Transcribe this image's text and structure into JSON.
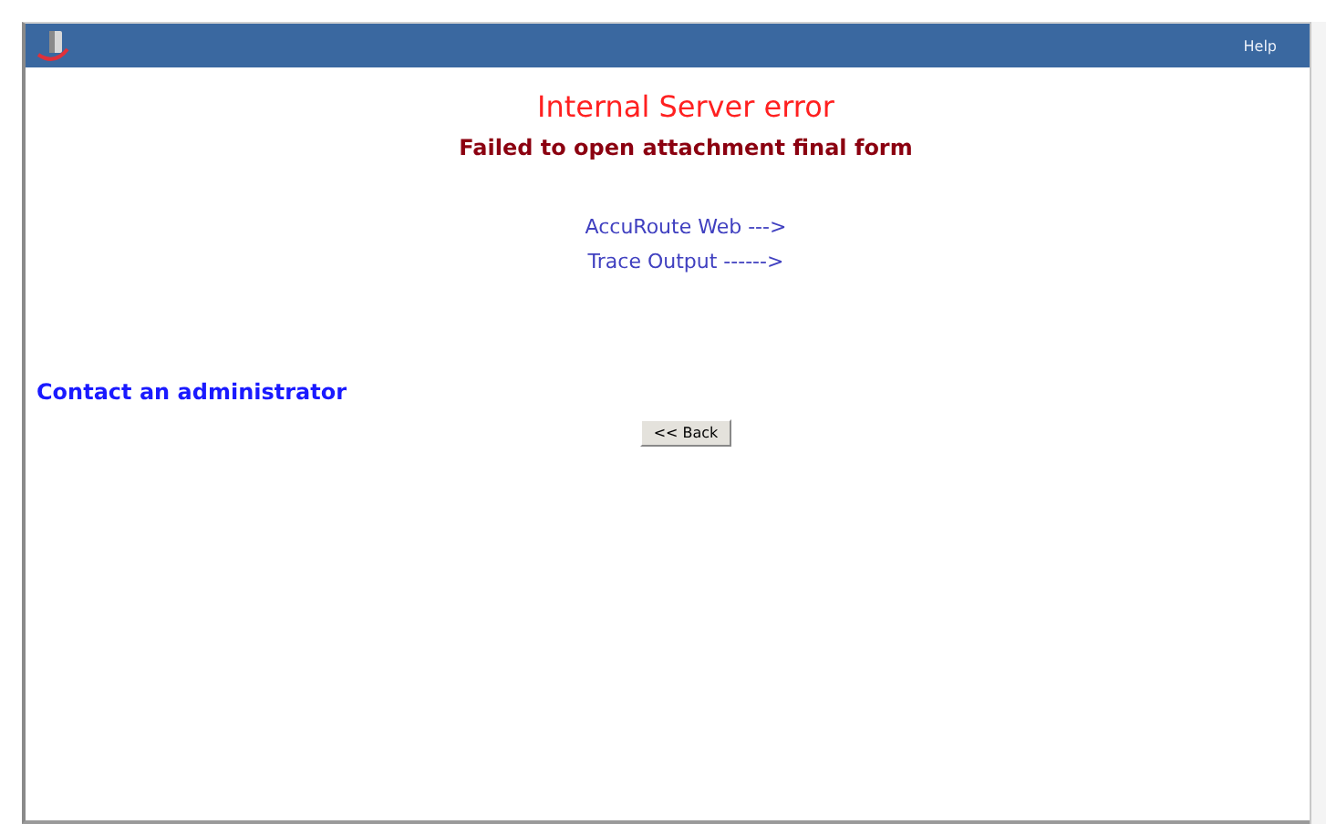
{
  "header": {
    "help_link": "Help"
  },
  "error": {
    "title": "Internal Server error",
    "message": "Failed to open attachment final form"
  },
  "links": [
    {
      "label": "AccuRoute Web --->"
    },
    {
      "label": "Trace Output ------>"
    }
  ],
  "contact": "Contact an administrator",
  "back_button": "<< Back"
}
